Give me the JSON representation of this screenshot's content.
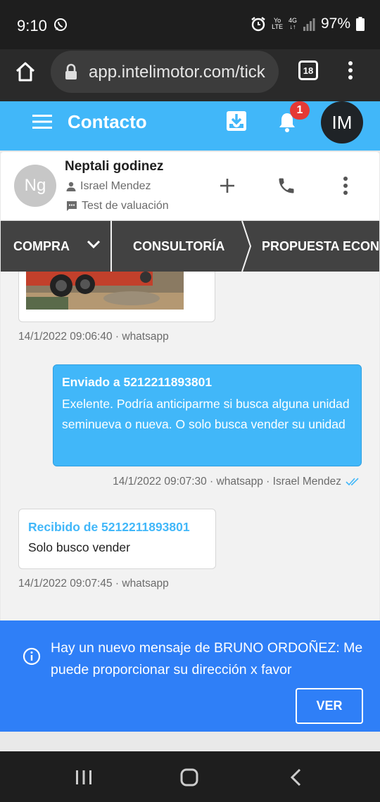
{
  "status_bar": {
    "time": "9:10",
    "volte_top": "Yo",
    "volte_bottom": "LTE",
    "network": "4G",
    "battery": "97%"
  },
  "browser": {
    "url": "app.intelimotor.com/tick",
    "tab_count": "18"
  },
  "header": {
    "title": "Contacto",
    "notification_count": "1",
    "user_initials": "IM"
  },
  "contact": {
    "initials": "Ng",
    "name": "Neptali godinez",
    "agent": "Israel Mendez",
    "tag": "Test de valuación"
  },
  "pipeline": {
    "stages": [
      "COMPRA",
      "CONSULTORÍA",
      "PROPUESTA ECONÓMICA"
    ]
  },
  "chat": {
    "messages": [
      {
        "meta": "14/1/2022 09:06:40 · whatsapp"
      },
      {
        "heading": "Enviado a 5212211893801",
        "text": "Exelente. Podría anticiparme si busca alguna unidad seminueva o nueva. O solo busca vender su unidad",
        "meta": "14/1/2022 09:07:30 · whatsapp · Israel Mendez"
      },
      {
        "heading": "Recibido de 5212211893801",
        "text": "Solo busco vender",
        "meta": "14/1/2022 09:07:45 · whatsapp"
      }
    ]
  },
  "snackbar": {
    "message": "Hay un nuevo mensaje de BRUNO ORDOÑEZ: Me puede proporcionar su dirección x favor",
    "action_label": "VER"
  },
  "colors": {
    "accent": "#41b7f9",
    "snackbar": "#2f7ff7",
    "badge": "#e53935",
    "pipeline": "#424242"
  }
}
